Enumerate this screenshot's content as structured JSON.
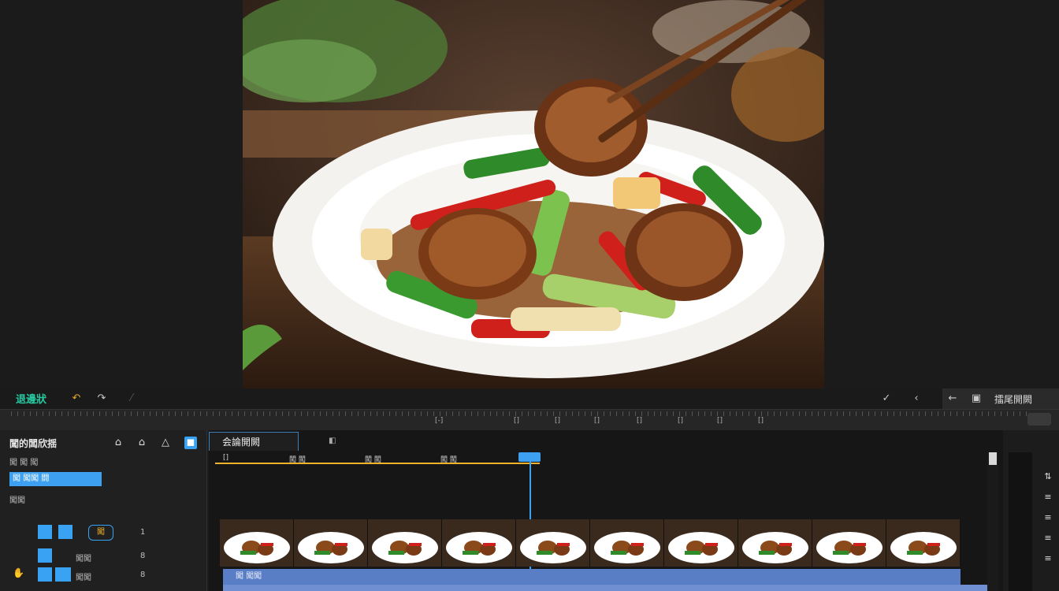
{
  "toolbar": {
    "brand": "退邊狀",
    "right_label": "擂尾開闕",
    "icons": [
      "undo-icon",
      "redo-icon",
      "check-icon",
      "close-icon",
      "back-arrow-icon",
      "export-icon"
    ]
  },
  "ruler": {
    "labels": [
      "[-]",
      "[]",
      "[]",
      "[]",
      "[]",
      "[]",
      "[]",
      "[]"
    ]
  },
  "left_panel": {
    "title": "闖的闆欣揺",
    "row1": "闖 闖 闖",
    "selected": "闖 闖闖 闘",
    "row3": "闖闖",
    "track_rows": [
      {
        "label": "闖",
        "value": "1"
      },
      {
        "label": "闖闖",
        "value": "8"
      },
      {
        "label": "闖闖",
        "value": "8"
      }
    ]
  },
  "timeline": {
    "tab_label": "会論開闕",
    "markers": [
      "[]",
      "闖 闖",
      "闖 闖",
      "闖 闖"
    ],
    "clip_label": "闖 闖闖"
  },
  "colors": {
    "accent": "#3da0f0",
    "brand": "#27c7a0",
    "playbar": "#f0b22a",
    "clip": "#5a7ec6"
  }
}
